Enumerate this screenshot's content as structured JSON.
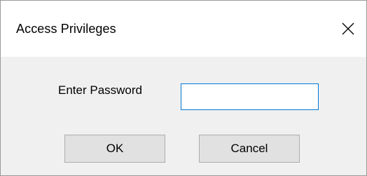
{
  "window": {
    "title": "Access Privileges",
    "close_icon": "close-icon"
  },
  "form": {
    "password_label": "Enter Password",
    "password_value": "",
    "password_placeholder": ""
  },
  "buttons": {
    "ok_label": "OK",
    "cancel_label": "Cancel"
  },
  "colors": {
    "input_focus_border": "#0078d7",
    "client_background": "#f0f0f0",
    "button_background": "#e1e1e1",
    "button_border": "#adadad"
  }
}
